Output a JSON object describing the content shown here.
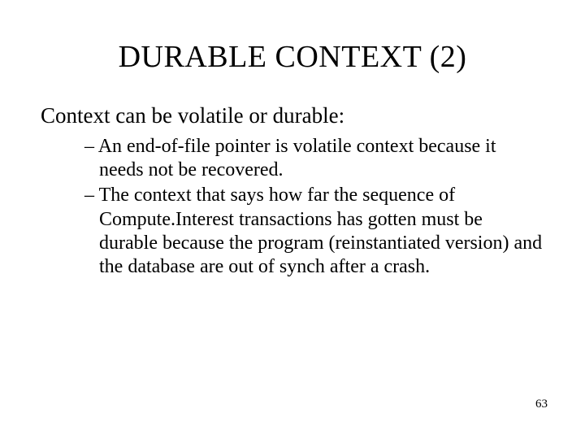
{
  "title": "DURABLE CONTEXT (2)",
  "intro": "Context can be volatile or durable:",
  "bullets": [
    "An end-of-file pointer is volatile context because it needs not be recovered.",
    "The context that says how far the sequence of Compute.Interest transactions has gotten must be durable because the program (reinstantiated version) and the database are out of synch after a crash."
  ],
  "page_number": "63"
}
